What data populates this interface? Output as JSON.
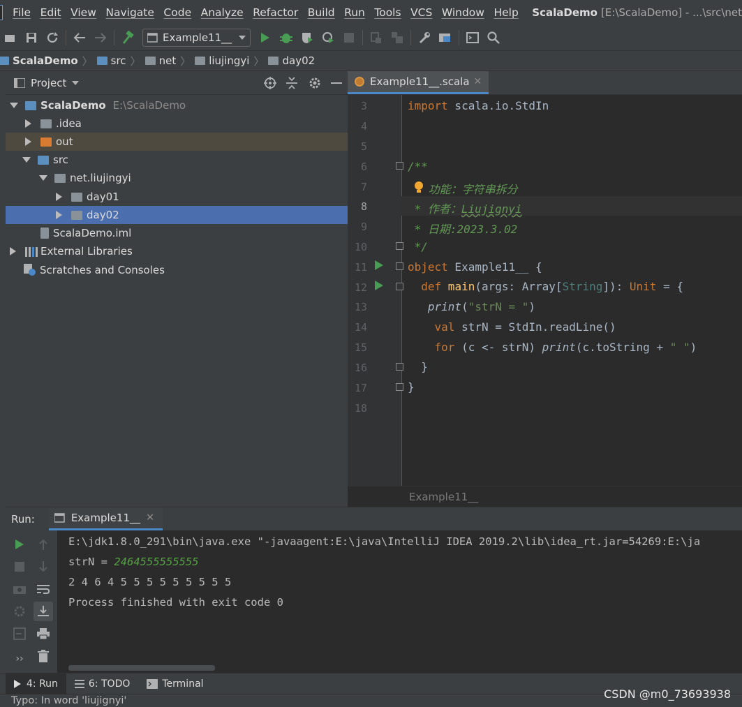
{
  "menubar": {
    "items": [
      "File",
      "Edit",
      "View",
      "Navigate",
      "Code",
      "Analyze",
      "Refactor",
      "Build",
      "Run",
      "Tools",
      "VCS",
      "Window",
      "Help"
    ],
    "project_title": "ScalaDemo",
    "path_title": "[E:\\ScalaDemo] - ...\\src\\net"
  },
  "toolbar": {
    "run_config": "Example11__"
  },
  "breadcrumb": {
    "items": [
      "ScalaDemo",
      "src",
      "net",
      "liujingyi",
      "day02"
    ]
  },
  "project_panel": {
    "title": "Project",
    "tree": [
      {
        "label": "ScalaDemo",
        "hint": "E:\\ScalaDemo"
      },
      {
        "label": ".idea"
      },
      {
        "label": "out"
      },
      {
        "label": "src"
      },
      {
        "label": "net.liujingyi"
      },
      {
        "label": "day01"
      },
      {
        "label": "day02"
      },
      {
        "label": "ScalaDemo.iml"
      },
      {
        "label": "External Libraries"
      },
      {
        "label": "Scratches and Consoles"
      }
    ]
  },
  "editor": {
    "tab_label": "Example11__.scala",
    "line_numbers": [
      "3",
      "4",
      "5",
      "6",
      "7",
      "8",
      "9",
      "10",
      "11",
      "12",
      "13",
      "14",
      "15",
      "16",
      "17",
      "18"
    ],
    "code": {
      "l3_kw": "import",
      "l3_rest": " scala.io.StdIn",
      "l6": "/**",
      "l7": " 功能：字符串拆分",
      "l8_a": " * 作者：",
      "l8_b": "Liujignyi",
      "l9": " * 日期:2023.3.02",
      "l10": " */",
      "l11_kw": "object",
      "l11_rest": " Example11__ {",
      "l12_kw": "  def",
      "l12_fn": " main",
      "l12_a": "(args: Array[",
      "l12_ty": "String",
      "l12_b": "]): ",
      "l12_unit": "Unit",
      "l12_c": " = {",
      "l13_fn": "   print",
      "l13_a": "(",
      "l13_str": "\"strN = \"",
      "l13_b": ")",
      "l14_kw": "    val",
      "l14_rest": " strN = StdIn.readLine()",
      "l15_kw": "    for",
      "l15_a": " (c <- strN) ",
      "l15_fn": "print",
      "l15_b": "(c.toString + ",
      "l15_str": "\" \"",
      "l15_c": ")",
      "l16": "  }",
      "l17": "}"
    },
    "breadcrumb": "Example11__"
  },
  "run_panel": {
    "label": "Run:",
    "tab_label": "Example11__",
    "console": {
      "cmd": "E:\\jdk1.8.0_291\\bin\\java.exe \"-javaagent:E:\\java\\IntelliJ IDEA 2019.2\\lib\\idea_rt.jar=54269:E:\\ja",
      "prompt": "strN = ",
      "input": "2464555555555",
      "output": "2 4 6 4 5 5 5 5 5 5 5 5 5",
      "exit": "Process finished with exit code 0"
    }
  },
  "bottom_tabs": {
    "run": "4: Run",
    "todo": "6: TODO",
    "terminal": "Terminal"
  },
  "status_bar": {
    "text": "Typo: In word 'liujignyi'"
  },
  "watermark": "CSDN @m0_73693938"
}
